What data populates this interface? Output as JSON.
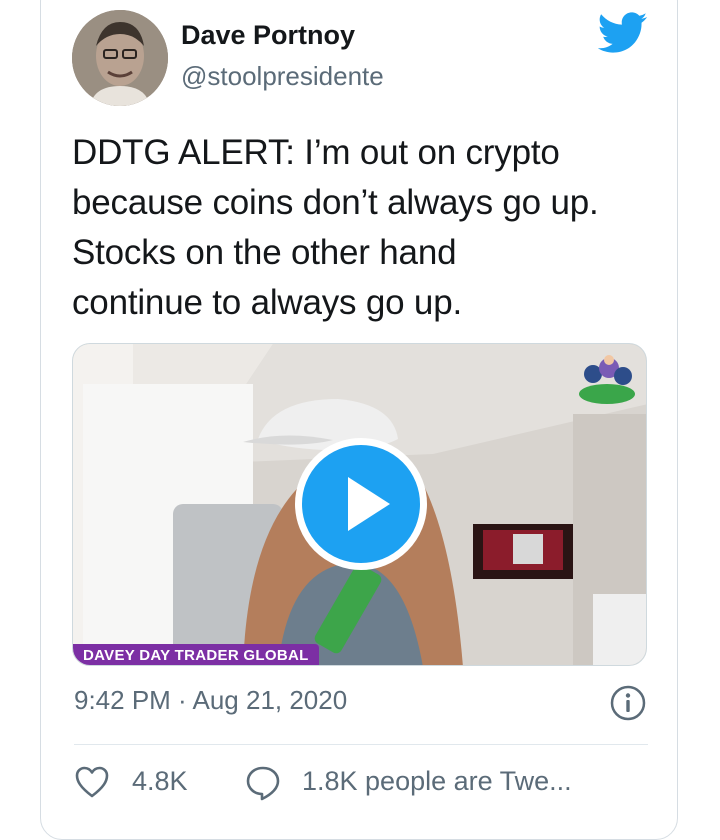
{
  "tweet": {
    "author_name": "Dave Portnoy",
    "author_handle": "@stoolpresidente",
    "text_lines": [
      "DDTG ALERT: I’m out on crypto",
      "because coins don’t always go up.",
      "Stocks on the other hand",
      "continue to always go up."
    ],
    "timestamp": "9:42 PM · Aug 21, 2020"
  },
  "media": {
    "banner_text": "DAVEY DAY TRADER GLOBAL"
  },
  "actions": {
    "likes": "4.8K",
    "replies_text": "1.8K people are Twe..."
  },
  "colors": {
    "twitter_blue": "#1da1f2",
    "banner_purple": "#7c2fa4",
    "muted_text": "#5b6b78"
  },
  "icons": {
    "brand": "twitter-bird-icon",
    "info": "info-icon",
    "like": "heart-icon",
    "reply": "comment-bubble-icon",
    "play": "play-icon"
  }
}
